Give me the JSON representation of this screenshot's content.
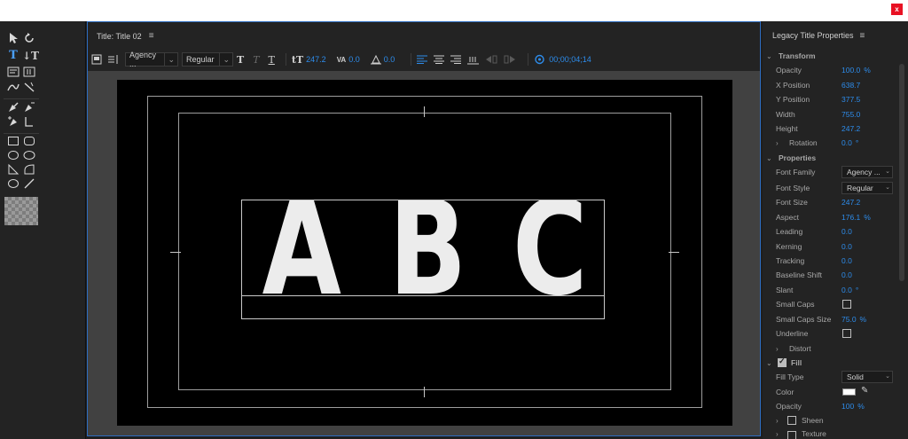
{
  "window": {
    "close_label": "x"
  },
  "title_panel": {
    "title": "Title: Title 02",
    "toolbar": {
      "font_family": "Agency ...",
      "font_style": "Regular",
      "font_size": "247.2",
      "kerning": "0.0",
      "leading": "0.0",
      "timecode": "00;00;04;14"
    },
    "canvas_text": [
      "A",
      "B",
      "C"
    ]
  },
  "properties": {
    "title": "Legacy Title Properties",
    "transform": {
      "label": "Transform",
      "opacity_label": "Opacity",
      "opacity_value": "100.0",
      "opacity_unit": "%",
      "x_label": "X Position",
      "x_value": "638.7",
      "y_label": "Y Position",
      "y_value": "377.5",
      "width_label": "Width",
      "width_value": "755.0",
      "height_label": "Height",
      "height_value": "247.2",
      "rotation_label": "Rotation",
      "rotation_value": "0.0",
      "rotation_unit": "°"
    },
    "props": {
      "label": "Properties",
      "font_family_label": "Font Family",
      "font_family_value": "Agency ...",
      "font_style_label": "Font Style",
      "font_style_value": "Regular",
      "font_size_label": "Font Size",
      "font_size_value": "247.2",
      "aspect_label": "Aspect",
      "aspect_value": "176.1",
      "aspect_unit": "%",
      "leading_label": "Leading",
      "leading_value": "0.0",
      "kerning_label": "Kerning",
      "kerning_value": "0.0",
      "tracking_label": "Tracking",
      "tracking_value": "0.0",
      "baseline_label": "Baseline Shift",
      "baseline_value": "0.0",
      "slant_label": "Slant",
      "slant_value": "0.0",
      "slant_unit": "°",
      "small_caps_label": "Small Caps",
      "small_caps_checked": false,
      "small_caps_size_label": "Small Caps Size",
      "small_caps_size_value": "75.0",
      "small_caps_size_unit": "%",
      "underline_label": "Underline",
      "underline_checked": false,
      "distort_label": "Distort"
    },
    "fill": {
      "label": "Fill",
      "checked": true,
      "fill_type_label": "Fill Type",
      "fill_type_value": "Solid",
      "color_label": "Color",
      "color_value": "#ffffff",
      "opacity_label": "Opacity",
      "opacity_value": "100",
      "opacity_unit": "%",
      "sheen_label": "Sheen",
      "texture_label": "Texture"
    }
  },
  "colors": {
    "accent": "#2d8ceb",
    "panel": "#232323",
    "canvas": "#000000",
    "focus_border": "#2d6cc0"
  }
}
